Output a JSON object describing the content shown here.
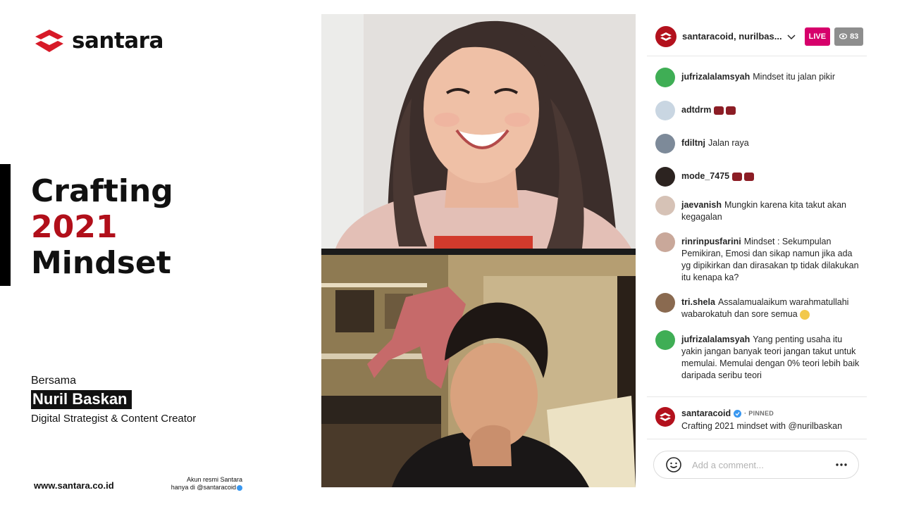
{
  "brand": {
    "name": "santara",
    "accent": "#d71a28"
  },
  "headline": {
    "line1": "Crafting",
    "year": "2021",
    "line3": "Mindset",
    "year_color": "#b10f1a"
  },
  "host": {
    "with_label": "Bersama",
    "name": "Nuril Baskan",
    "role": "Digital Strategist & Content Creator"
  },
  "footer": {
    "site": "www.santara.co.id",
    "official_line1": "Akun resmi Santara",
    "official_line2": "hanya di @santaracoid"
  },
  "live": {
    "names": "santaracoid, nurilbas...",
    "live_label": "LIVE",
    "viewer_count": "83",
    "live_color": "#d6006b"
  },
  "comments": [
    {
      "user": "jufrizalalamsyah",
      "text": "Mindset itu jalan pikir",
      "avatar_color": "#3fae55"
    },
    {
      "user": "adtdrm",
      "text": "",
      "emojis": 2,
      "avatar_color": "#c9d6e2"
    },
    {
      "user": "fdiltnj",
      "text": "Jalan raya",
      "avatar_color": "#7d8a99"
    },
    {
      "user": "mode_7475",
      "text": "",
      "emojis": 2,
      "avatar_color": "#2c2320"
    },
    {
      "user": "jaevanish",
      "text": "Mungkin karena kita takut akan kegagalan",
      "avatar_color": "#d6c2b6"
    },
    {
      "user": "rinrinpusfarini",
      "text": "Mindset : Sekumpulan Pemikiran, Emosi dan sikap namun jika ada yg dipikirkan dan dirasakan tp tidak dilakukan itu kenapa ka?",
      "avatar_color": "#c9a89a"
    },
    {
      "user": "tri.shela",
      "text": "Assalamualaikum warahmatullahi wabarokatuh dan sore semua",
      "smile": true,
      "avatar_color": "#8a6a50"
    },
    {
      "user": "jufrizalalamsyah",
      "text": "Yang penting usaha itu yakin jangan banyak teori jangan takut untuk memulai. Memulai dengan 0% teori lebih baik daripada seribu teori",
      "avatar_color": "#3fae55"
    }
  ],
  "pinned": {
    "user": "santaracoid",
    "tag": "PINNED",
    "text": "Crafting 2021 mindset with @nurilbaskan"
  },
  "comment_box": {
    "placeholder": "Add a comment..."
  }
}
